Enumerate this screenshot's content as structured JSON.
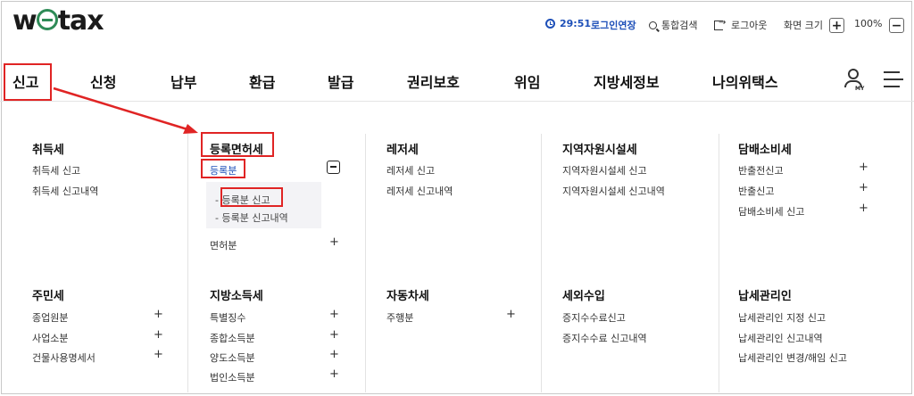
{
  "header": {
    "logo": "wetax",
    "timer": "29:51",
    "extend_login": "로그인연장",
    "search": "통합검색",
    "logout": "로그아웃",
    "zoom_label": "화면 크기",
    "zoom_plus": "+",
    "zoom_value": "100%",
    "zoom_minus": "−"
  },
  "nav": {
    "items": [
      "신고",
      "신청",
      "납부",
      "환급",
      "발급",
      "권리보호",
      "위임",
      "지방세정보",
      "나의위택스"
    ],
    "my_label": "MY"
  },
  "menu": {
    "acquisition": {
      "title": "취득세",
      "items": [
        "취득세 신고",
        "취득세 신고내역"
      ]
    },
    "registration": {
      "title": "등록면허세",
      "group1": "등록분",
      "group1_sub": [
        "- 등록분 신고",
        "- 등록분 신고내역"
      ],
      "group2": "면허분"
    },
    "leisure": {
      "title": "레저세",
      "items": [
        "레저세 신고",
        "레저세 신고내역"
      ]
    },
    "regional": {
      "title": "지역자원시설세",
      "items": [
        "지역자원시설세 신고",
        "지역자원시설세 신고내역"
      ]
    },
    "tobacco": {
      "title": "담배소비세",
      "items": [
        "반출전신고",
        "반출신고",
        "담배소비세 신고"
      ]
    },
    "resident": {
      "title": "주민세",
      "items": [
        "종업원분",
        "사업소분",
        "건물사용명세서"
      ]
    },
    "income": {
      "title": "지방소득세",
      "items": [
        "특별징수",
        "종합소득분",
        "양도소득분",
        "법인소득분"
      ]
    },
    "vehicle": {
      "title": "자동차세",
      "items": [
        "주행분"
      ]
    },
    "nontax": {
      "title": "세외수입",
      "items": [
        "증지수수료신고",
        "증지수수료 신고내역"
      ]
    },
    "agent": {
      "title": "납세관리인",
      "items": [
        "납세관리인 지정 신고",
        "납세관리인 신고내역",
        "납세관리인 변경/해임 신고"
      ]
    }
  },
  "symbols": {
    "plus": "+"
  },
  "colors": {
    "highlight": "#e02424",
    "link_blue": "#1d4fb8",
    "brand_green": "#2e8b57"
  }
}
